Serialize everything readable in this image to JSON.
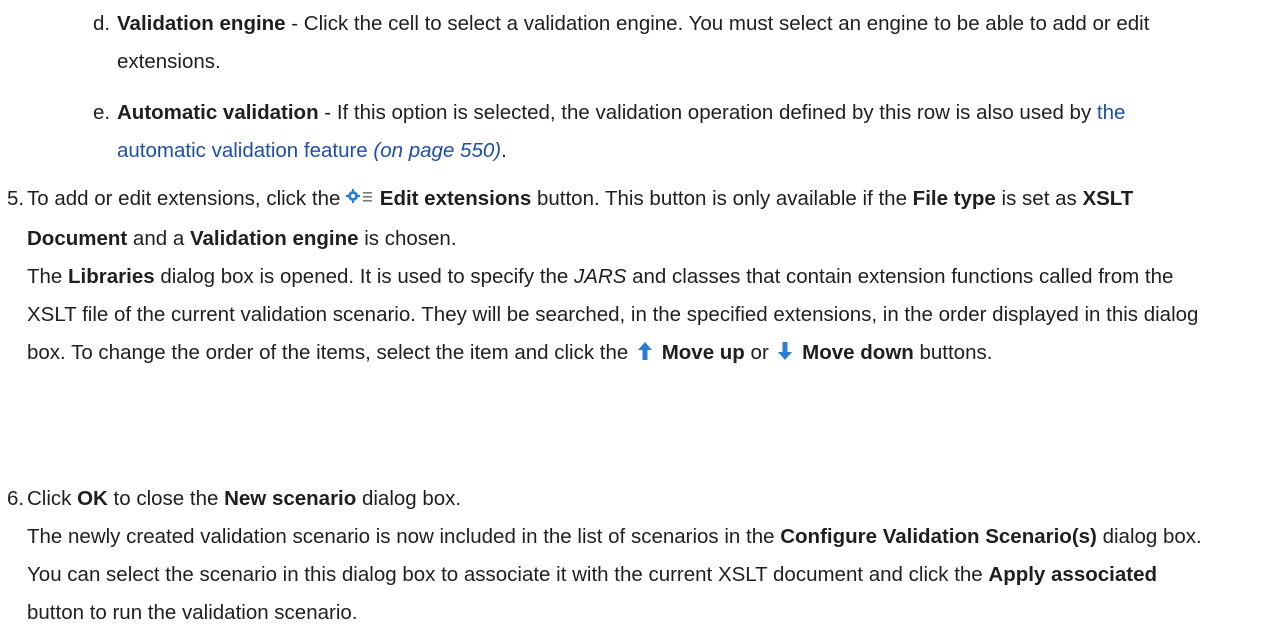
{
  "substeps": [
    {
      "marker": "d.",
      "term": "Validation engine",
      "text": " - Click the cell to select a validation engine. You must select an engine to be able to add or edit extensions."
    },
    {
      "marker": "e.",
      "term": "Automatic validation",
      "text_before_link": " - If this option is selected, the validation operation defined by this row is also used by ",
      "link_text": "the automatic validation feature",
      "link_ref": "(on page 550)",
      "text_after_link": "."
    }
  ],
  "step5": {
    "marker": "5.",
    "p1_a": "To add or edit extensions, click the ",
    "edit_extensions": "Edit extensions",
    "p1_b": " button. This button is only available if the ",
    "file_type": "File type",
    "p1_c": " is set as ",
    "xslt_document": "XSLT Document",
    "p1_d": " and a ",
    "validation_engine": "Validation engine",
    "p1_e": " is chosen.",
    "p2_a": "The ",
    "libraries": "Libraries",
    "p2_b": " dialog box is opened. It is used to specify the ",
    "jars": "JARS",
    "p2_c": " and classes that contain extension functions called from the XSLT file of the current validation scenario. They will be searched, in the specified extensions, in the order displayed in this dialog box. To change the order of the items, select the item and click the ",
    "move_up": "Move up",
    "p2_d": " or ",
    "move_down": "Move down",
    "p2_e": " buttons."
  },
  "step6": {
    "marker": "6.",
    "p1_a": "Click ",
    "ok": "OK",
    "p1_b": " to close the ",
    "new_scenario": "New scenario",
    "p1_c": " dialog box.",
    "p2_a": "The newly created validation scenario is now included in the list of scenarios in the ",
    "configure": "Configure Validation Scenario(s)",
    "p2_b": " dialog box. You can select the scenario in this dialog box to associate it with the current XSLT document and click the ",
    "apply_associated": "Apply associated",
    "p2_c": " button to run the validation scenario."
  },
  "icons": {
    "edit_extensions": "gear-list-icon",
    "move_up": "arrow-up-icon",
    "move_down": "arrow-down-icon"
  },
  "colors": {
    "text": "#1f1f1f",
    "link": "#1e4fa6",
    "icon_blue": "#2a7fd4"
  }
}
